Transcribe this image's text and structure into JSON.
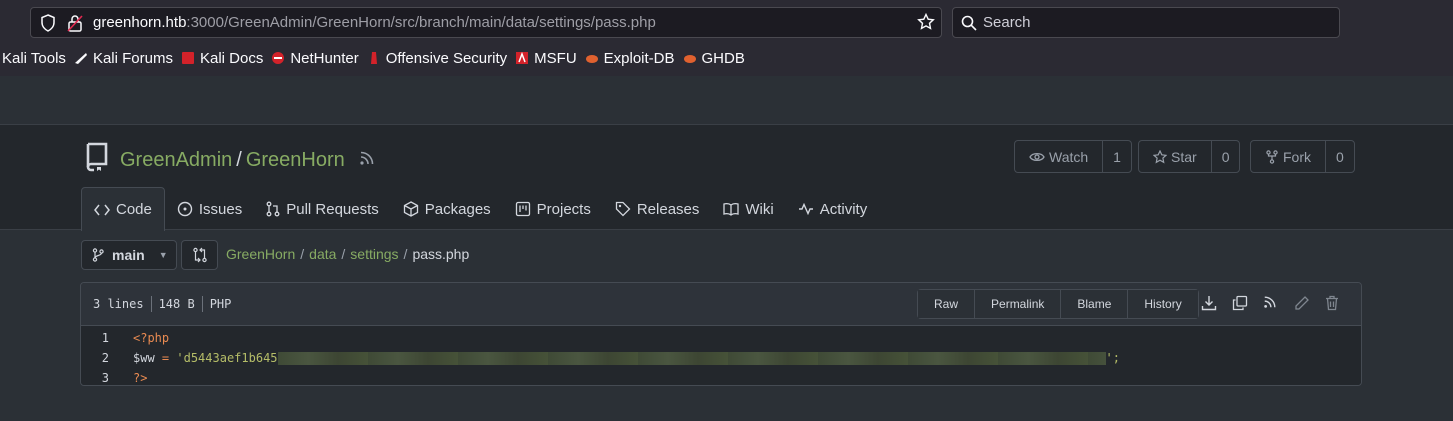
{
  "browser": {
    "url_host": "greenhorn.htb",
    "url_rest": ":3000/GreenAdmin/GreenHorn/src/branch/main/data/settings/pass.php",
    "search_placeholder": "Search",
    "bookmarks": [
      "Kali Tools",
      "Kali Forums",
      "Kali Docs",
      "NetHunter",
      "Offensive Security",
      "MSFU",
      "Exploit-DB",
      "GHDB"
    ]
  },
  "repo": {
    "owner": "GreenAdmin",
    "separator": "/",
    "name": "GreenHorn",
    "watch_label": "Watch",
    "watch_count": "1",
    "star_label": "Star",
    "star_count": "0",
    "fork_label": "Fork",
    "fork_count": "0"
  },
  "tabs": [
    "Code",
    "Issues",
    "Pull Requests",
    "Packages",
    "Projects",
    "Releases",
    "Wiki",
    "Activity"
  ],
  "branch": {
    "name": "main"
  },
  "breadcrumb": {
    "root": "GreenHorn",
    "dir1": "data",
    "dir2": "settings",
    "file": "pass.php",
    "sep": "/"
  },
  "file": {
    "lines_count": "3 lines",
    "size": "148 B",
    "language": "PHP",
    "actions": [
      "Raw",
      "Permalink",
      "Blame",
      "History"
    ],
    "code": {
      "line1": "<?php",
      "line2_var": "$ww",
      "line2_eq": " = ",
      "line2_str": "'d5443aef1b645",
      "line2_end": "';",
      "line3": "?>"
    }
  },
  "colors": {
    "accent": "#87ab63",
    "bg": "#2b3036",
    "header_bg": "#23272c",
    "keyword": "#e88a51",
    "string": "#b5bd68"
  }
}
